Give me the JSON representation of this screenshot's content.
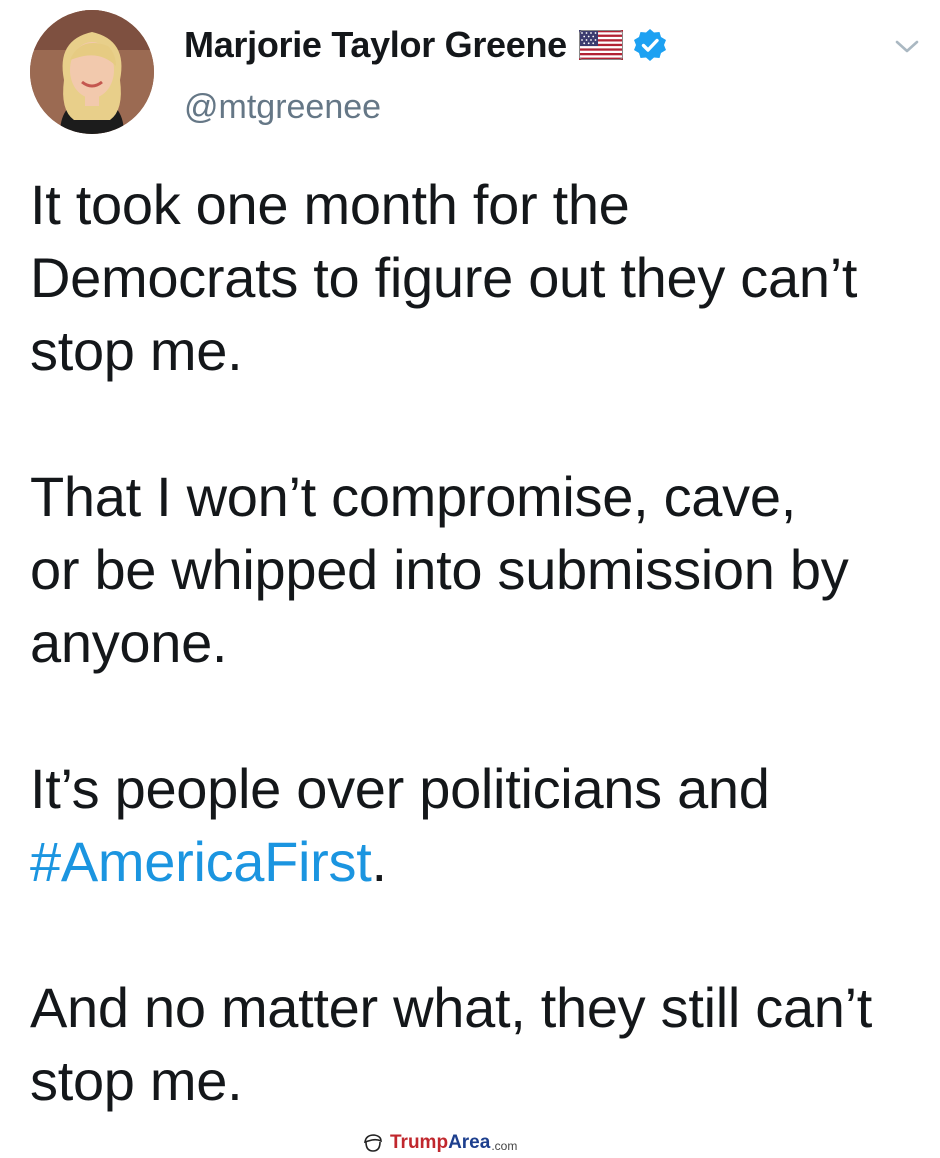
{
  "profile": {
    "display_name": "Marjorie Taylor Greene",
    "handle": "@mtgreenee",
    "flag_icon": "us-flag-icon",
    "verified_icon": "verified-badge-icon",
    "menu_icon": "chevron-down-icon"
  },
  "tweet": {
    "p1": "It took one month for the\nDemocrats to figure out they can’t\nstop me.",
    "p2": "That I won’t compromise, cave,\nor be whipped into submission by\nanyone.",
    "p3_before": "It’s people over politicians and\n",
    "p3_hashtag": "#AmericaFirst",
    "p3_after": ".",
    "p4": "And no matter what, they still can’t\nstop me."
  },
  "watermark": {
    "part1": "Trump",
    "part2": "Area",
    "part3": ".com"
  },
  "colors": {
    "hashtag": "#1b95e0",
    "handle": "#657786",
    "verified": "#1da1f2",
    "text": "#14171a"
  }
}
